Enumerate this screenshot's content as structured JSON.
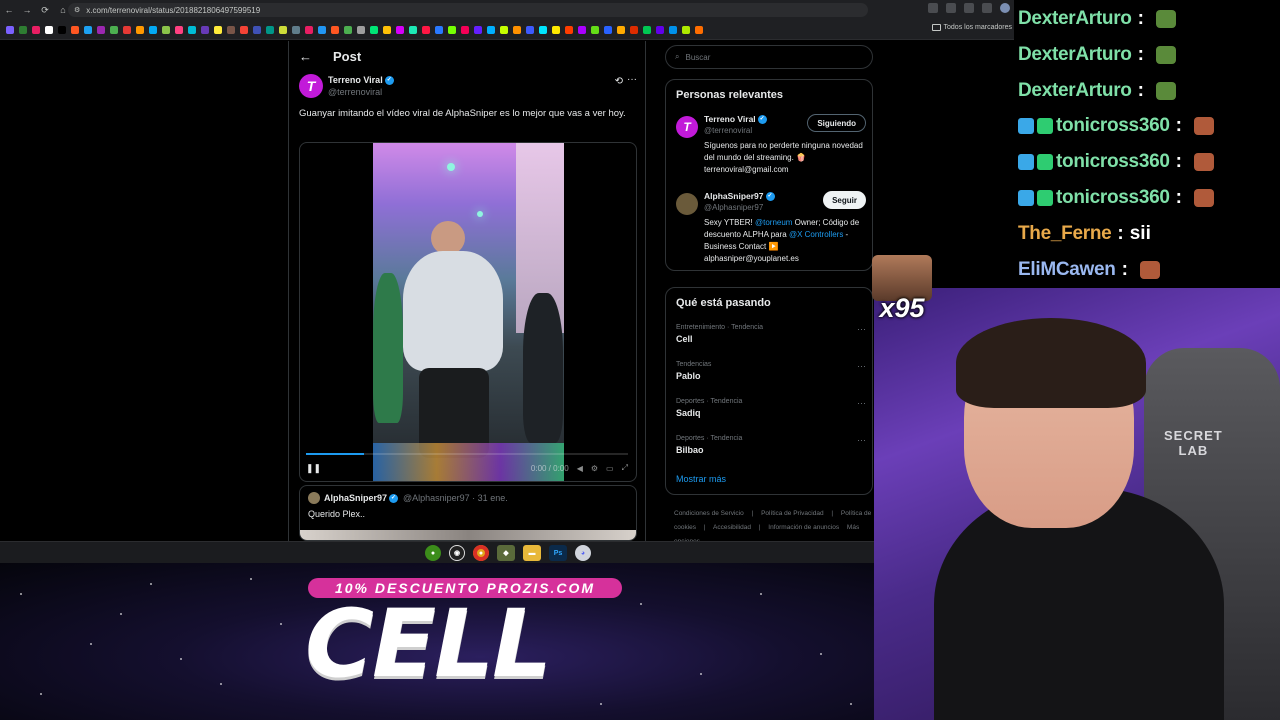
{
  "browser": {
    "url": "x.com/terrenoviral/status/2018821806497599519",
    "bookmarks_folder": "Todos los marcadores"
  },
  "post": {
    "header_title": "Post",
    "author": {
      "name": "Terreno Viral",
      "handle": "@terrenoviral",
      "avatar_letter": "T"
    },
    "text": "Guanyar imitando el vídeo viral de AlphaSniper es lo mejor que vas a ver hoy.",
    "video": {
      "time": "0:00 / 0:00",
      "progress": 0.18
    },
    "quote": {
      "name": "AlphaSniper97",
      "meta": "@Alphasniper97 · 31 ene.",
      "text": "Querido Plex.."
    }
  },
  "sidebar": {
    "search_placeholder": "Buscar",
    "relevant": {
      "title": "Personas relevantes",
      "people": [
        {
          "name": "Terreno Viral",
          "handle": "@terrenoviral",
          "bio": "Síguenos para no perderte ninguna novedad del mundo del streaming. 🍿 terrenoviral@gmail.com",
          "button": "Siguiendo"
        },
        {
          "name": "AlphaSniper97",
          "handle": "@Alphasniper97",
          "bio_a": "Sexy YTBER! ",
          "bio_link1": "@torneum",
          "bio_b": " Owner; Código de descuento ALPHA para ",
          "bio_link2": "@X Controllers",
          "bio_c": " - Business Contact ▶️ alphasniper@youplanet.es",
          "button": "Seguir"
        }
      ]
    },
    "trends": {
      "title": "Qué está pasando",
      "items": [
        {
          "category": "Entretenimiento · Tendencia",
          "name": "Cell"
        },
        {
          "category": "Tendencias",
          "name": "Pablo"
        },
        {
          "category": "Deportes · Tendencia",
          "name": "Sadiq"
        },
        {
          "category": "Deportes · Tendencia",
          "name": "Bilbao"
        }
      ],
      "show_more": "Mostrar más"
    },
    "footer": [
      "Condiciones de Servicio",
      "|",
      "Política de Privacidad",
      "|",
      "Política de cookies",
      "|",
      "Accesibilidad",
      "|",
      "Información de anuncios",
      "Más opciones"
    ]
  },
  "taskbar": {
    "apps": [
      "xbox",
      "obs",
      "chrome",
      "app",
      "files",
      "Ps",
      "discord"
    ]
  },
  "overlay": {
    "promo": "10% DESCUENTO PROZIS.COM",
    "trend_banner": "CELL",
    "emote_count": "x95",
    "chair_logo_line1": "SECRET",
    "chair_logo_line2": "LAB"
  },
  "chat": [
    {
      "user": "DexterArturo",
      "color": "#7fe0a8",
      "msg": "",
      "emote": "#5a8a3a",
      "badges": 0
    },
    {
      "user": "DexterArturo",
      "color": "#7fe0a8",
      "msg": "",
      "emote": "#5a8a3a",
      "badges": 0
    },
    {
      "user": "DexterArturo",
      "color": "#7fe0a8",
      "msg": "",
      "emote": "#5a8a3a",
      "badges": 0
    },
    {
      "user": "tonicross360",
      "color": "#7fe0a8",
      "msg": "",
      "emote": "#b05a3a",
      "badges": 2
    },
    {
      "user": "tonicross360",
      "color": "#7fe0a8",
      "msg": "",
      "emote": "#b05a3a",
      "badges": 2
    },
    {
      "user": "tonicross360",
      "color": "#7fe0a8",
      "msg": "",
      "emote": "#b05a3a",
      "badges": 2
    },
    {
      "user": "The_Ferne",
      "color": "#e8a94a",
      "msg": "sii",
      "emote": "",
      "badges": 0
    },
    {
      "user": "EliMCawen",
      "color": "#9ab8f0",
      "msg": "",
      "emote": "#b05a3a",
      "badges": 0
    }
  ]
}
